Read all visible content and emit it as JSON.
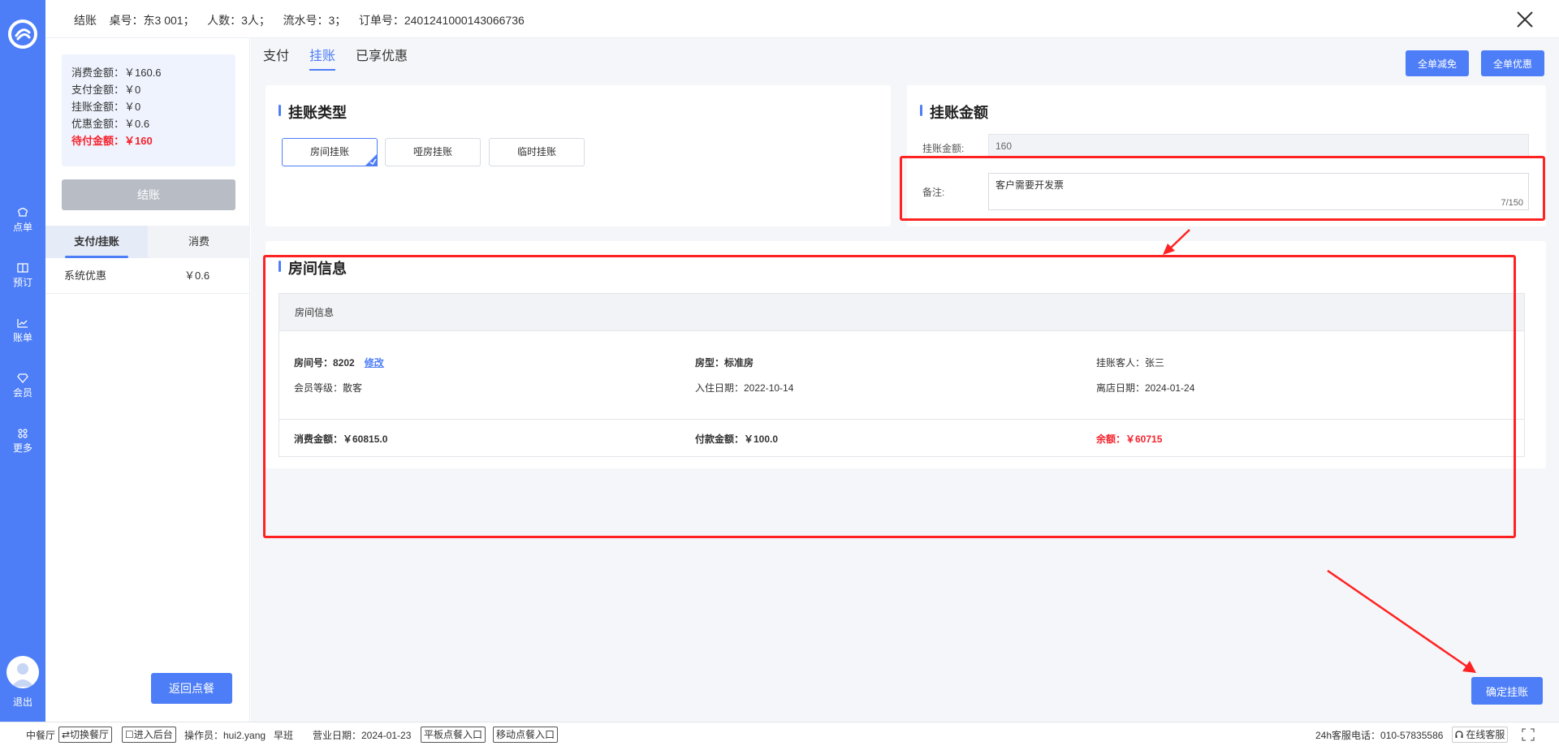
{
  "nav": {
    "items": [
      {
        "label": "点单",
        "icon": "chef-hat-icon"
      },
      {
        "label": "预订",
        "icon": "book-icon"
      },
      {
        "label": "账单",
        "icon": "chart-icon"
      },
      {
        "label": "会员",
        "icon": "diamond-icon"
      },
      {
        "label": "更多",
        "icon": "grid-icon"
      }
    ],
    "exit_label": "退出"
  },
  "header": {
    "info": "结账    桌号：东3 001；    人数：3人；    流水号：3；    订单号：2401241000143066736"
  },
  "summary": {
    "consume": "消费金额：￥160.6",
    "paid": "支付金额：￥0",
    "onaccount": "挂账金额：￥0",
    "discount": "优惠金额：￥0.6",
    "due": "待付金额：￥160"
  },
  "left": {
    "checkout_label": "结账",
    "tabs": [
      "支付/挂账",
      "消费"
    ],
    "promo_name": "系统优惠",
    "promo_value": "￥0.6",
    "back_label": "返回点餐"
  },
  "main": {
    "tabs": [
      "支付",
      "挂账",
      "已享优惠"
    ],
    "btn_reduce": "全单减免",
    "btn_discount": "全单优惠"
  },
  "type_card": {
    "title": "挂账类型",
    "options": [
      "房间挂账",
      "哑房挂账",
      "临时挂账"
    ]
  },
  "amount_card": {
    "title": "挂账金额",
    "amount_label": "挂账金额:",
    "amount_value": "160",
    "remark_label": "备注:",
    "remark_value": "客户需要开发票",
    "remark_count": "7/150"
  },
  "room": {
    "title": "房间信息",
    "header": "房间信息",
    "room_no": "房间号：8202",
    "edit": "修改",
    "room_type": "房型：标准房",
    "guest": "挂账客人：张三",
    "member_level": "会员等级：散客",
    "checkin": "入住日期：2022-10-14",
    "checkout": "离店日期：2024-01-24",
    "consume": "消费金额：￥60815.0",
    "paid": "付款金额：￥100.0",
    "balance": "余额：￥60715"
  },
  "confirm_label": "确定挂账",
  "status": {
    "restaurant": "中餐厅",
    "switch": "⇄切换餐厅",
    "backend": "☐进入后台",
    "operator": "操作员：hui2.yang",
    "shift": "早班",
    "bizdate": "营业日期：2024-01-23",
    "tablet": "平板点餐入口",
    "mobile": "移动点餐入口",
    "hotline": "24h客服电话：010-57835586",
    "online": "在线客服"
  },
  "colors": {
    "primary": "#4d7ef7",
    "danger": "#f5222d",
    "annotation": "#ff2222"
  }
}
